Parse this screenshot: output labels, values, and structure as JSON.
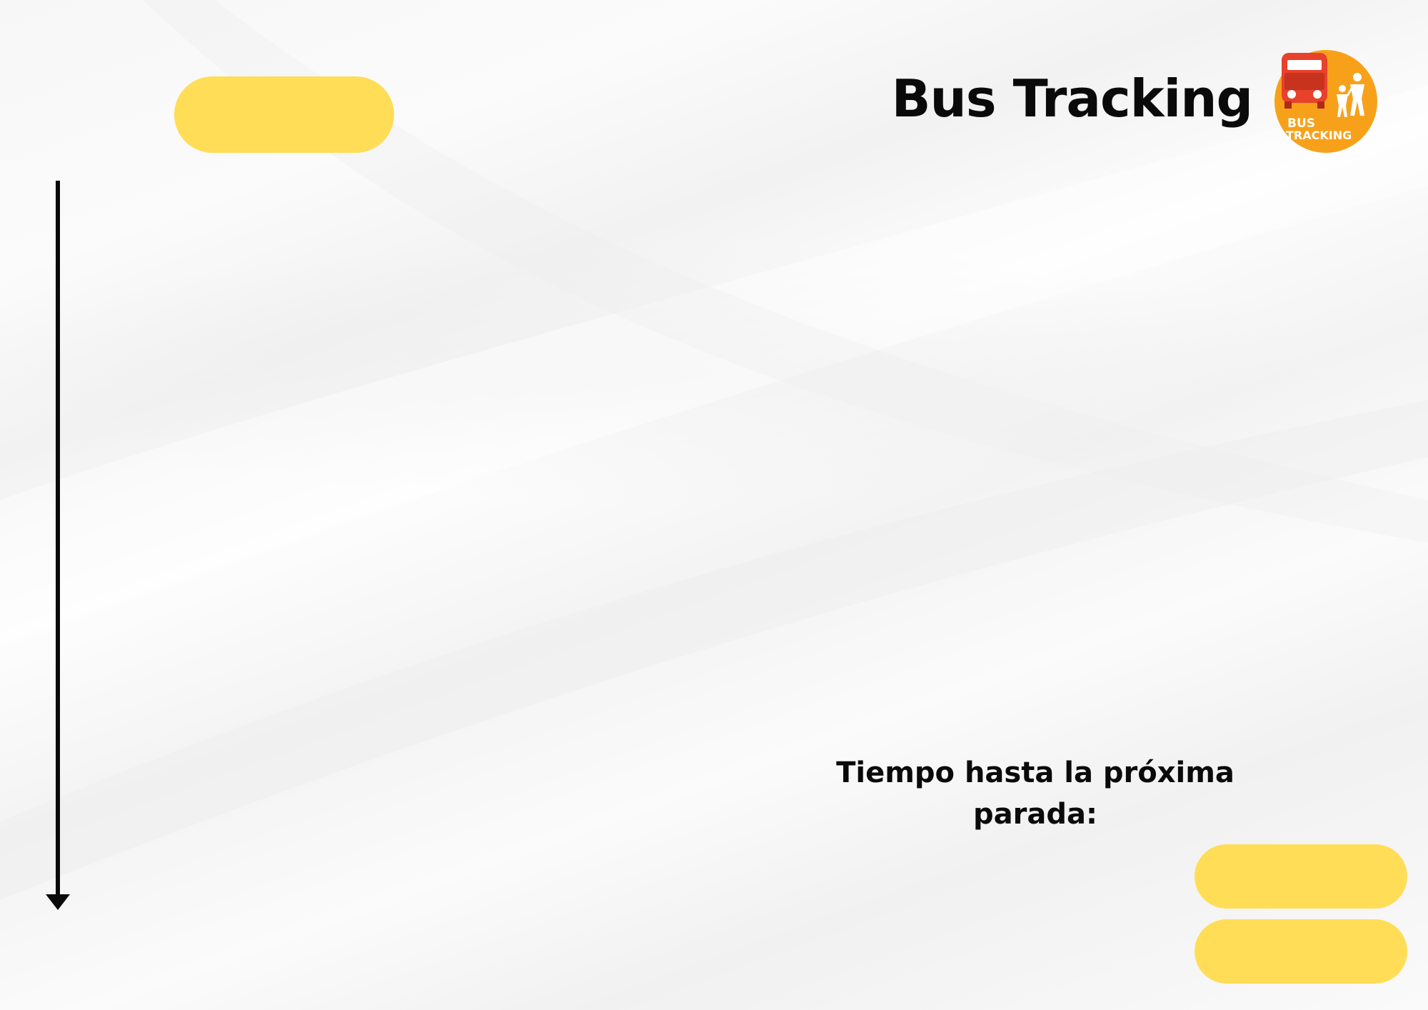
{
  "header": {
    "title": "Bus Tracking",
    "logo_text_line1": "BUS",
    "logo_text_line2": "TRACKING"
  },
  "top_pill": {
    "label": ""
  },
  "next_stop": {
    "label": "Tiempo hasta la próxima parada:",
    "value_primary": "",
    "value_secondary": ""
  },
  "colors": {
    "accent_yellow": "#FFDD57",
    "logo_orange": "#F7A11A",
    "logo_bus_red": "#E8412C",
    "text_dark": "#0A0A0A"
  },
  "icons": {
    "logo": "bus-tracking-logo-icon",
    "timeline": "down-arrow-icon"
  }
}
